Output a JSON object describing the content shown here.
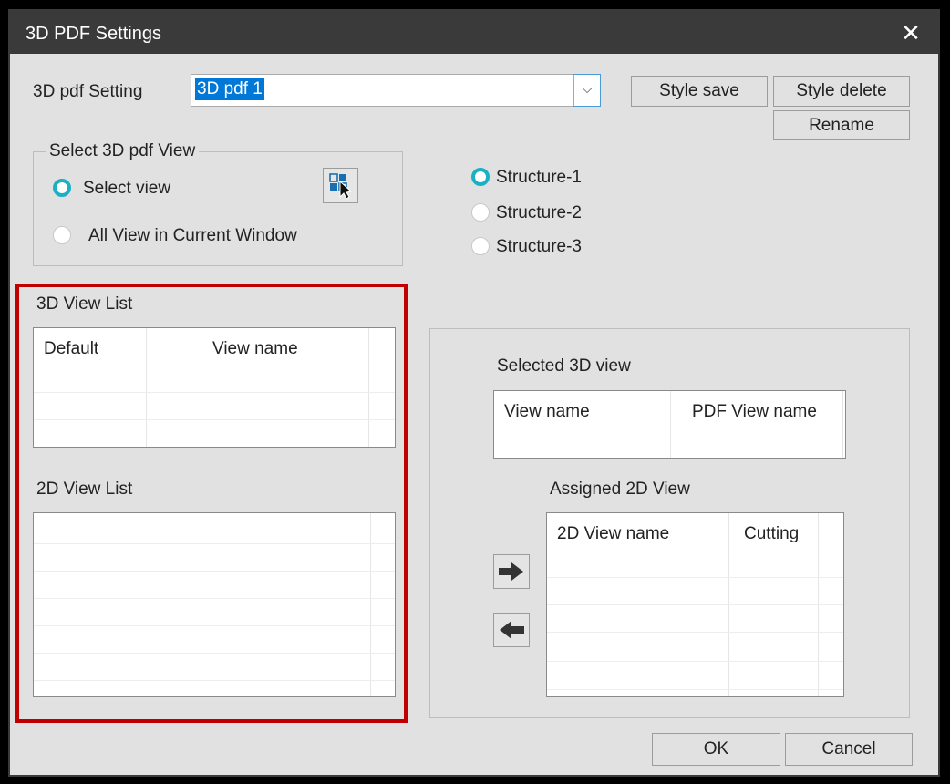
{
  "window": {
    "title": "3D PDF Settings",
    "close_glyph": "✕"
  },
  "setting": {
    "label": "3D pdf Setting",
    "value": "3D pdf  1",
    "dropdown_glyph": "⌵",
    "style_save": "Style save",
    "style_delete": "Style delete",
    "rename": "Rename"
  },
  "select_view": {
    "title": "Select 3D pdf View",
    "option_select_view": "Select view",
    "option_all_view": "All View in Current Window",
    "selected": "Select view",
    "picker_icon": "view-picker-icon"
  },
  "structure": {
    "options": [
      "Structure-1",
      "Structure-2",
      "Structure-3"
    ],
    "selected": "Structure-1"
  },
  "view_list_3d": {
    "title": "3D View List",
    "columns": [
      "Default",
      "View name"
    ]
  },
  "view_list_2d": {
    "title": "2D View List"
  },
  "selected_3d": {
    "title": "Selected 3D view",
    "columns": [
      "View name",
      "PDF View name"
    ]
  },
  "assigned_2d": {
    "title": "Assigned 2D View",
    "columns": [
      "2D View name",
      "Cutting"
    ]
  },
  "footer": {
    "ok": "OK",
    "cancel": "Cancel"
  },
  "colors": {
    "highlight": "#c00000",
    "radio_checked": "#1cb0c4",
    "selection": "#0078d7"
  }
}
